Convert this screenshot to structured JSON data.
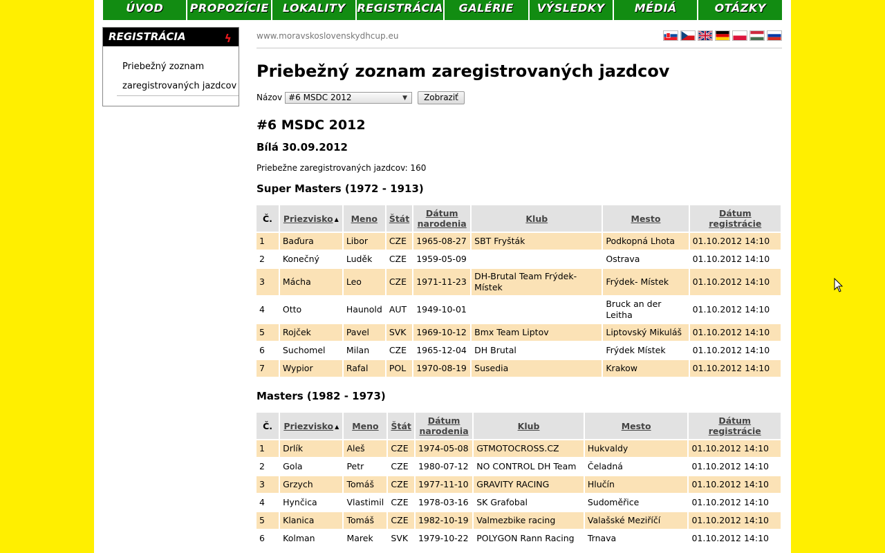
{
  "nav": [
    "ÚVOD",
    "PROPOZÍCIE",
    "LOKALITY",
    "REGISTRÁCIA",
    "GALÉRIE",
    "VÝSLEDKY",
    "MÉDIÁ",
    "OTÁZKY"
  ],
  "sidebar": {
    "title": "REGISTRÁCIA",
    "link": "Priebežný zoznam zaregistrovaných jazdcov"
  },
  "site_url": "www.moravskoslovenskydhcup.eu",
  "languages": [
    {
      "name": "slovak-flag-icon"
    },
    {
      "name": "czech-flag-icon"
    },
    {
      "name": "uk-flag-icon"
    },
    {
      "name": "german-flag-icon"
    },
    {
      "name": "polish-flag-icon"
    },
    {
      "name": "hungarian-flag-icon"
    },
    {
      "name": "russian-flag-icon"
    }
  ],
  "page_title": "Priebežný zoznam zaregistrovaných jazdcov",
  "filter": {
    "label": "Názov",
    "selected": "#6 MSDC 2012",
    "button": "Zobraziť"
  },
  "event": {
    "title": "#6 MSDC 2012",
    "subtitle": "Bílá 30.09.2012",
    "count_text": "Priebežne zaregistrovaných jazdcov: 160"
  },
  "columns": {
    "num": "Č.",
    "surname": "Priezvisko",
    "name": "Meno",
    "country": "Štát",
    "birth": "Dátum narodenia",
    "club": "Klub",
    "city": "Mesto",
    "reg": "Dátum registrácie"
  },
  "categories": [
    {
      "title": "Super Masters (1972 - 1913)",
      "rows": [
        [
          "1",
          "Baďura",
          "Libor",
          "CZE",
          "1965-08-27",
          "SBT Fryšták",
          "Podkopná Lhota",
          "01.10.2012 14:10"
        ],
        [
          "2",
          "Konečný",
          "Luděk",
          "CZE",
          "1959-05-09",
          "",
          "Ostrava",
          "01.10.2012 14:10"
        ],
        [
          "3",
          "Mácha",
          "Leo",
          "CZE",
          "1971-11-23",
          "DH-Brutal Team Frýdek-Místek",
          "Frýdek- Místek",
          "01.10.2012 14:10"
        ],
        [
          "4",
          "Otto",
          "Haunold",
          "AUT",
          "1949-10-01",
          "",
          "Bruck an der Leitha",
          "01.10.2012 14:10"
        ],
        [
          "5",
          "Rojček",
          "Pavel",
          "SVK",
          "1969-10-12",
          "Bmx Team Liptov",
          "Liptovský Mikuláš",
          "01.10.2012 14:10"
        ],
        [
          "6",
          "Suchomel",
          "Milan",
          "CZE",
          "1965-12-04",
          "DH Brutal",
          "Frýdek Místek",
          "01.10.2012 14:10"
        ],
        [
          "7",
          "Wypior",
          "Rafal",
          "POL",
          "1970-08-19",
          "Susedia",
          "Krakow",
          "01.10.2012 14:10"
        ]
      ]
    },
    {
      "title": "Masters (1982 - 1973)",
      "rows": [
        [
          "1",
          "Drlík",
          "Aleš",
          "CZE",
          "1974-05-08",
          "GTMOTOCROSS.CZ",
          "Hukvaldy",
          "01.10.2012 14:10"
        ],
        [
          "2",
          "Gola",
          "Petr",
          "CZE",
          "1980-07-12",
          "NO CONTROL DH Team",
          "Čeladná",
          "01.10.2012 14:10"
        ],
        [
          "3",
          "Grzych",
          "Tomáš",
          "CZE",
          "1977-11-10",
          "GRAVITY RACING",
          "Hlučín",
          "01.10.2012 14:10"
        ],
        [
          "4",
          "Hynčica",
          "Vlastimil",
          "CZE",
          "1978-03-16",
          "SK Grafobal",
          "Sudoměřice",
          "01.10.2012 14:10"
        ],
        [
          "5",
          "Klanica",
          "Tomáš",
          "CZE",
          "1982-10-19",
          "Valmezbike racing",
          "Valašské Meziříčí",
          "01.10.2012 14:10"
        ],
        [
          "6",
          "Kolman",
          "Marek",
          "SVK",
          "1979-10-22",
          "POLYGON Rann Racing",
          "Trnava",
          "01.10.2012 14:10"
        ]
      ]
    }
  ],
  "colors": {
    "background": "#ffef00",
    "nav": "#128c12",
    "row_highlight": "#fbe2b6",
    "header": "#e2e2e2"
  }
}
